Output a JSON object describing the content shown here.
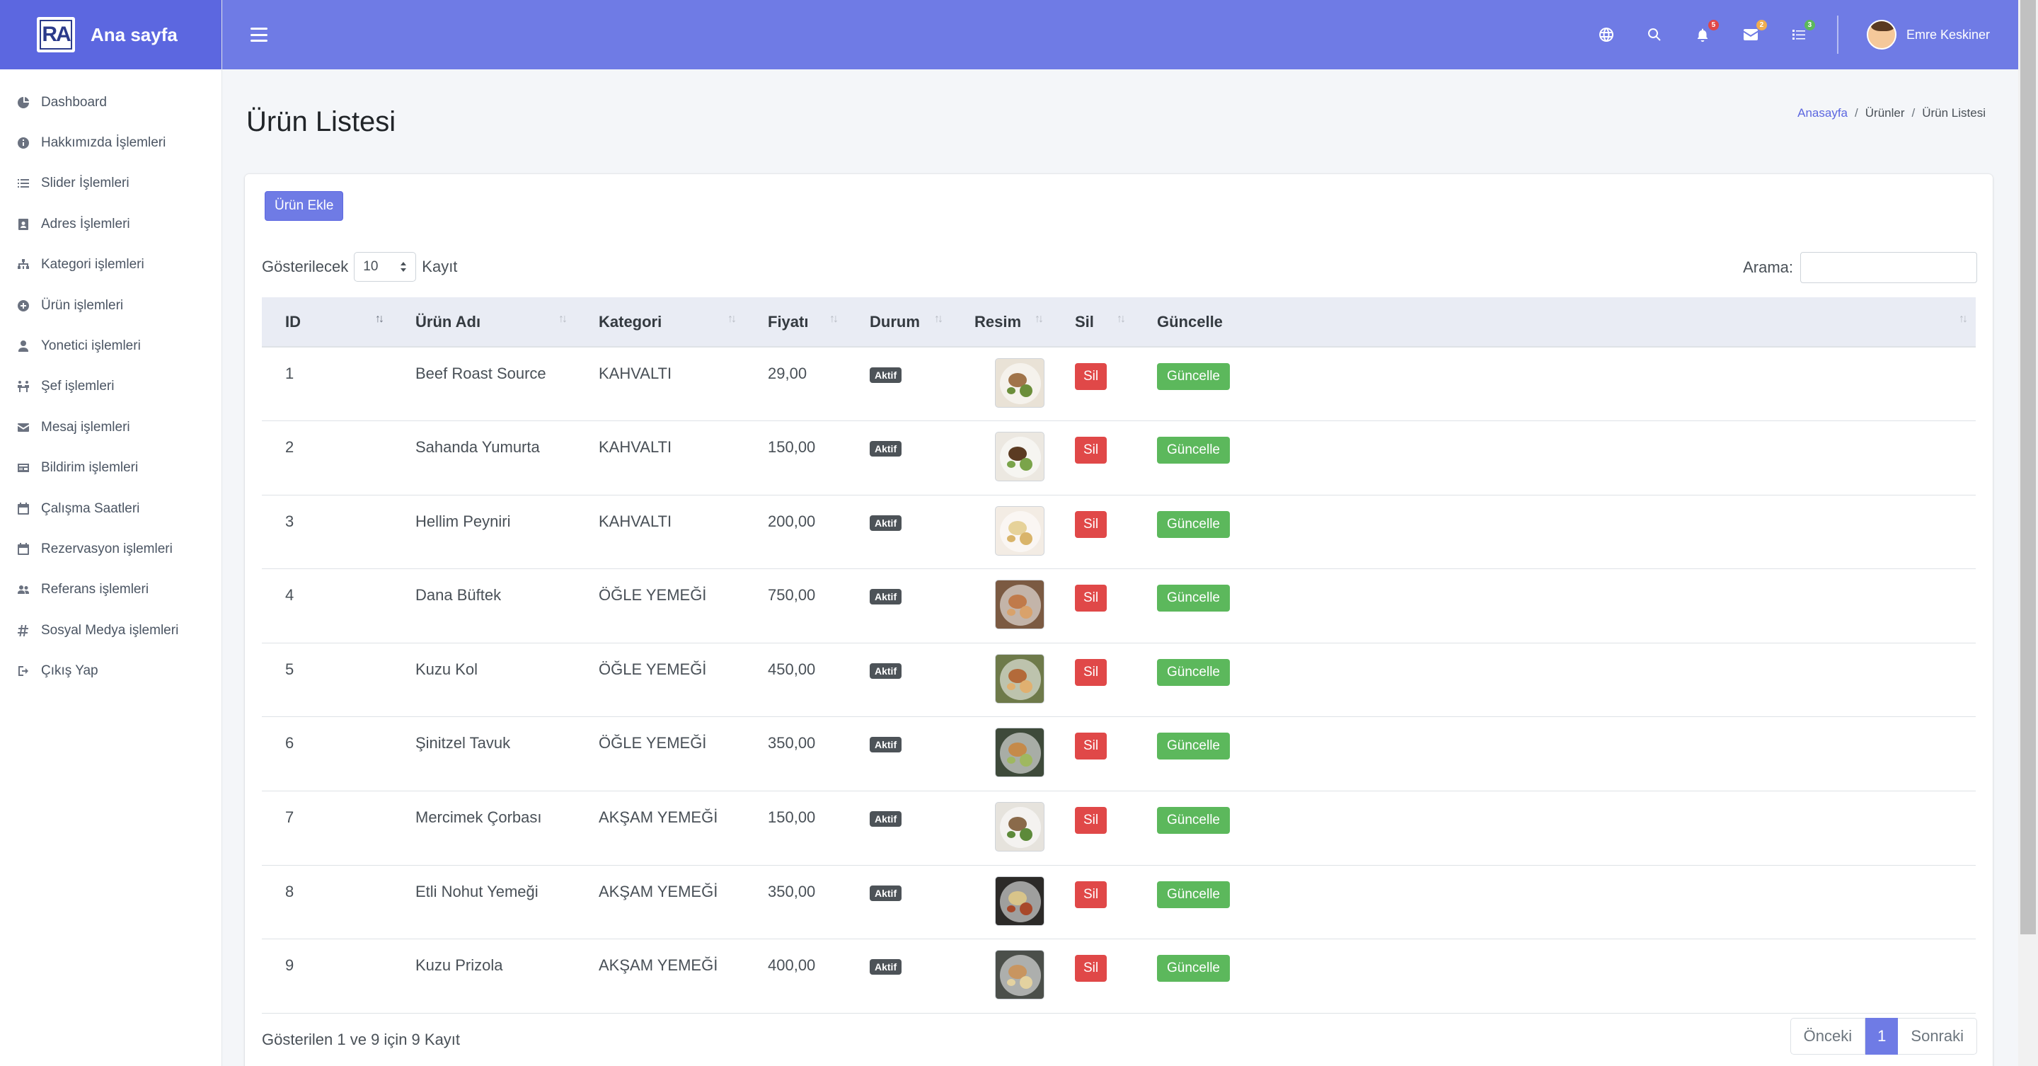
{
  "brand": {
    "logo_text": "RA",
    "title": "Ana sayfa"
  },
  "sidebar": {
    "items": [
      {
        "label": "Dashboard",
        "icon": "dashboard-icon"
      },
      {
        "label": "Hakkımızda İşlemleri",
        "icon": "info-icon"
      },
      {
        "label": "Slider İşlemleri",
        "icon": "list-icon"
      },
      {
        "label": "Adres İşlemleri",
        "icon": "address-card-icon"
      },
      {
        "label": "Kategori işlemleri",
        "icon": "sitemap-icon"
      },
      {
        "label": "Ürün işlemleri",
        "icon": "plus-circle-icon"
      },
      {
        "label": "Yonetici işlemleri",
        "icon": "user-icon"
      },
      {
        "label": "Şef işlemleri",
        "icon": "chef-icon"
      },
      {
        "label": "Mesaj işlemleri",
        "icon": "envelope-icon"
      },
      {
        "label": "Bildirim işlemleri",
        "icon": "notification-icon"
      },
      {
        "label": "Çalışma Saatleri",
        "icon": "calendar-icon"
      },
      {
        "label": "Rezervasyon işlemleri",
        "icon": "calendar-icon"
      },
      {
        "label": "Referans işlemleri",
        "icon": "users-icon"
      },
      {
        "label": "Sosyal Medya işlemleri",
        "icon": "hashtag-icon"
      },
      {
        "label": "Çıkış Yap",
        "icon": "sign-out-icon"
      }
    ]
  },
  "topbar": {
    "badges": {
      "notifications": "5",
      "messages": "2",
      "tasks": "3"
    },
    "badge_colors": {
      "notifications": "#e04848",
      "messages": "#f0ad4e",
      "tasks": "#5cb85c"
    },
    "user_name": "Emre Keskiner"
  },
  "page": {
    "title": "Ürün Listesi",
    "breadcrumb": {
      "home": "Anasayfa",
      "section": "Ürünler",
      "current": "Ürün Listesi"
    }
  },
  "card": {
    "add_button": "Ürün Ekle",
    "length_label_before": "Gösterilecek",
    "length_value": "10",
    "length_label_after": "Kayıt",
    "search_label": "Arama:",
    "search_value": ""
  },
  "table": {
    "columns": [
      "ID",
      "Ürün Adı",
      "Kategori",
      "Fiyatı",
      "Durum",
      "Resim",
      "Sil",
      "Güncelle"
    ],
    "rows": [
      {
        "id": "1",
        "name": "Beef Roast Source",
        "category": "KAHVALTI",
        "price": "29,00",
        "status": "Aktif",
        "delete": "Sil",
        "update": "Güncelle"
      },
      {
        "id": "2",
        "name": "Sahanda Yumurta",
        "category": "KAHVALTI",
        "price": "150,00",
        "status": "Aktif",
        "delete": "Sil",
        "update": "Güncelle"
      },
      {
        "id": "3",
        "name": "Hellim Peyniri",
        "category": "KAHVALTI",
        "price": "200,00",
        "status": "Aktif",
        "delete": "Sil",
        "update": "Güncelle"
      },
      {
        "id": "4",
        "name": "Dana Büftek",
        "category": "ÖĞLE YEMEĞİ",
        "price": "750,00",
        "status": "Aktif",
        "delete": "Sil",
        "update": "Güncelle"
      },
      {
        "id": "5",
        "name": "Kuzu Kol",
        "category": "ÖĞLE YEMEĞİ",
        "price": "450,00",
        "status": "Aktif",
        "delete": "Sil",
        "update": "Güncelle"
      },
      {
        "id": "6",
        "name": "Şinitzel Tavuk",
        "category": "ÖĞLE YEMEĞİ",
        "price": "350,00",
        "status": "Aktif",
        "delete": "Sil",
        "update": "Güncelle"
      },
      {
        "id": "7",
        "name": "Mercimek Çorbası",
        "category": "AKŞAM YEMEĞİ",
        "price": "150,00",
        "status": "Aktif",
        "delete": "Sil",
        "update": "Güncelle"
      },
      {
        "id": "8",
        "name": "Etli Nohut Yemeği",
        "category": "AKŞAM YEMEĞİ",
        "price": "350,00",
        "status": "Aktif",
        "delete": "Sil",
        "update": "Güncelle"
      },
      {
        "id": "9",
        "name": "Kuzu Prizola",
        "category": "AKŞAM YEMEĞİ",
        "price": "400,00",
        "status": "Aktif",
        "delete": "Sil",
        "update": "Güncelle"
      }
    ]
  },
  "footer": {
    "info": "Gösterilen 1 ve 9 için 9 Kayıt",
    "prev": "Önceki",
    "current_page": "1",
    "next": "Sonraki"
  },
  "colors": {
    "primary": "#6f7be5",
    "danger": "#e04848",
    "success": "#5cb85c",
    "badge_dark": "#4d5358"
  }
}
